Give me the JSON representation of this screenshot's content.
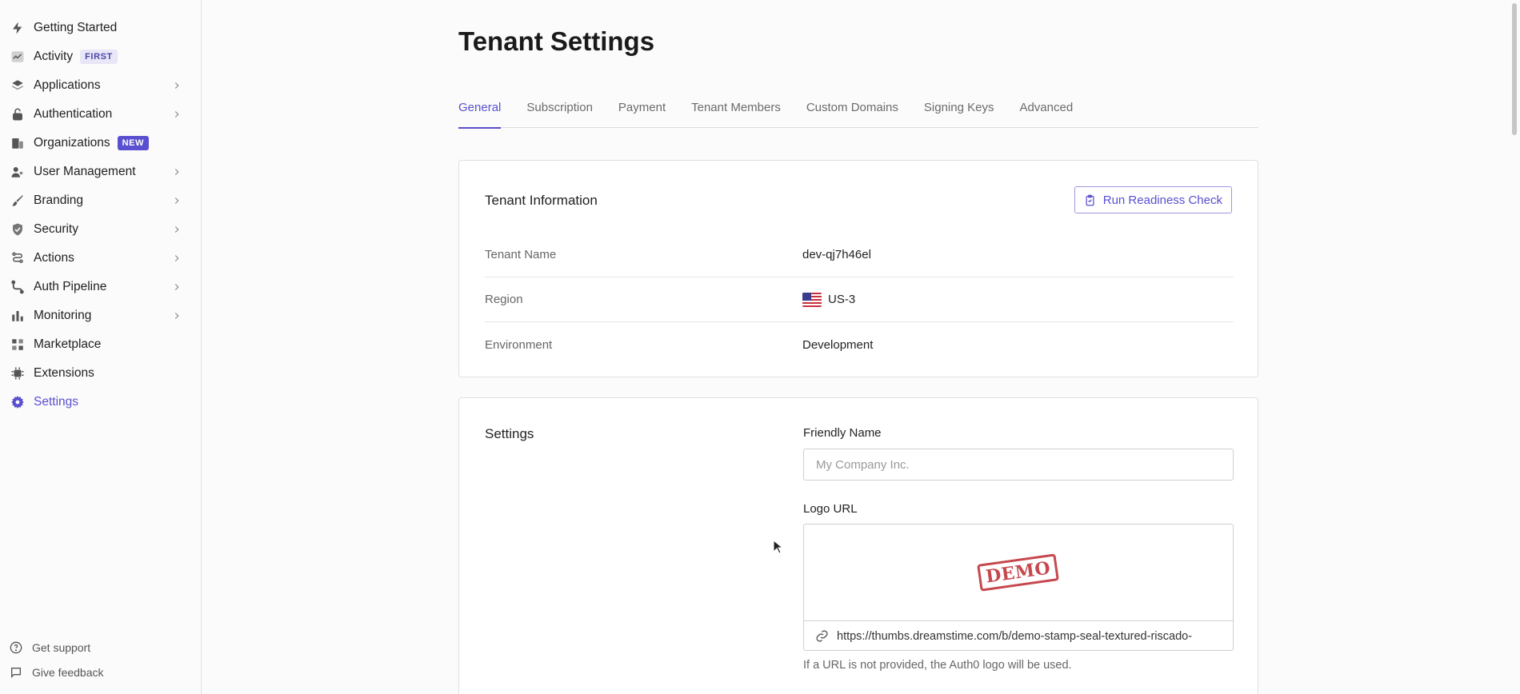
{
  "sidebar": {
    "items": [
      {
        "label": "Getting Started",
        "icon": "lightning-icon"
      },
      {
        "label": "Activity",
        "icon": "activity-chart-icon",
        "badge": "FIRST"
      },
      {
        "label": "Applications",
        "icon": "layers-icon"
      },
      {
        "label": "Authentication",
        "icon": "lock-icon"
      },
      {
        "label": "Organizations",
        "icon": "building-icon",
        "badge": "NEW"
      },
      {
        "label": "User Management",
        "icon": "users-icon"
      },
      {
        "label": "Branding",
        "icon": "brush-icon"
      },
      {
        "label": "Security",
        "icon": "shield-icon"
      },
      {
        "label": "Actions",
        "icon": "flow-icon"
      },
      {
        "label": "Auth Pipeline",
        "icon": "pipeline-icon"
      },
      {
        "label": "Monitoring",
        "icon": "bar-chart-icon"
      },
      {
        "label": "Marketplace",
        "icon": "grid-icon"
      },
      {
        "label": "Extensions",
        "icon": "chip-icon"
      },
      {
        "label": "Settings",
        "icon": "gear-icon"
      }
    ],
    "footer": {
      "support": "Get support",
      "feedback": "Give feedback"
    }
  },
  "page": {
    "title": "Tenant Settings",
    "tabs": [
      "General",
      "Subscription",
      "Payment",
      "Tenant Members",
      "Custom Domains",
      "Signing Keys",
      "Advanced"
    ],
    "active_tab": "General"
  },
  "tenant_info": {
    "title": "Tenant Information",
    "readiness_button": "Run Readiness Check",
    "rows": [
      {
        "label": "Tenant Name",
        "value": "dev-qj7h46el"
      },
      {
        "label": "Region",
        "value": "US-3",
        "flag": "us-flag-icon"
      },
      {
        "label": "Environment",
        "value": "Development"
      }
    ]
  },
  "settings": {
    "title": "Settings",
    "friendly_name_label": "Friendly Name",
    "friendly_name_placeholder": "My Company Inc.",
    "friendly_name_value": "",
    "logo_url_label": "Logo URL",
    "logo_preview_text": "DEMO",
    "logo_url_value": "https://thumbs.dreamstime.com/b/demo-stamp-seal-textured-riscado-",
    "logo_helper": "If a URL is not provided, the Auth0 logo will be used."
  },
  "colors": {
    "accent": "#5a4fcf",
    "badge_new_bg": "#5a4fcf",
    "badge_first_bg": "#e8e6f7",
    "stamp": "#c0353b"
  }
}
